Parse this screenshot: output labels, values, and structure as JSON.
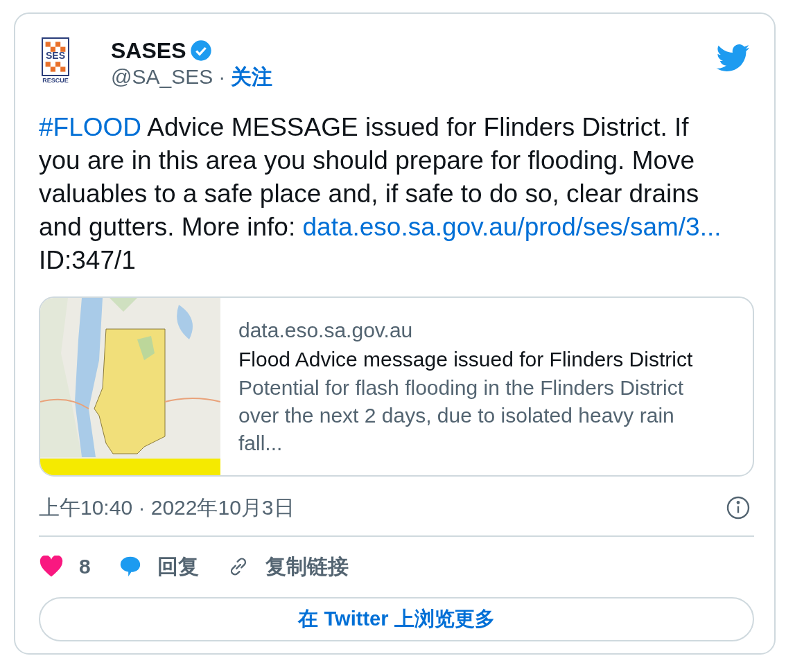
{
  "logo": {
    "top": "SES",
    "bottom": "RESCUE"
  },
  "author": {
    "name": "SASES",
    "verified": true,
    "handle": "@SA_SES",
    "separator": "·",
    "follow": "关注"
  },
  "tweet": {
    "hashtag": "#FLOOD",
    "text": "Advice MESSAGE issued for Flinders District. If you are in this area you should prepare for flooding. Move valuables to a safe place and, if safe to do so, clear drains and gutters. More info:",
    "link": "data.eso.sa.gov.au/prod/ses/sam/3...",
    "suffix": "ID:347/1"
  },
  "link_card": {
    "domain": "data.eso.sa.gov.au",
    "title": "Flood Advice message issued for Flinders District",
    "description": "Potential for flash flooding in the Flinders District over the next 2 days, due to isolated heavy rain fall..."
  },
  "timestamp": "上午10:40 · 2022年10月3日",
  "actions": [
    {
      "kind": "like",
      "label": "8"
    },
    {
      "kind": "reply",
      "label": "回复"
    },
    {
      "kind": "copy",
      "label": "复制链接"
    }
  ],
  "more_button": "在 Twitter 上浏览更多"
}
